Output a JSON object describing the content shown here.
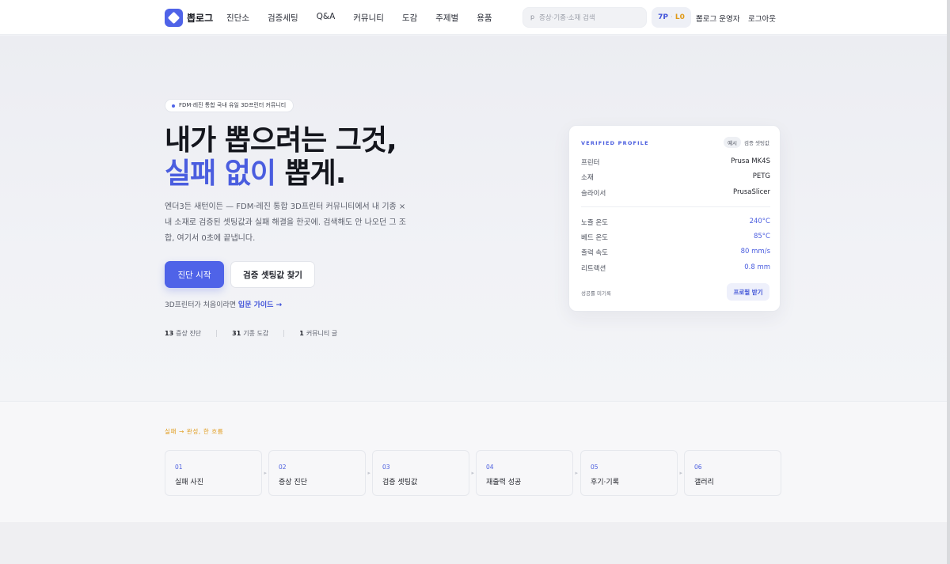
{
  "nav": {
    "logo_text": "뽑로그",
    "menu": [
      "진단소",
      "검증세팅",
      "Q&A",
      "커뮤니티",
      "도감",
      "주제별",
      "용품"
    ],
    "search_placeholder": "증상·기종·소재 검색",
    "search_icon": "p",
    "points": {
      "value": "7P",
      "separator": "·",
      "level": "L0"
    },
    "admin_link": "뽑로그 운영자",
    "logout_link": "로그아웃"
  },
  "hero": {
    "pill": "FDM·레진 통합 국내 유일 3D프린터 커뮤니티",
    "headline_line1": "내가 뽑으려는 그것,",
    "headline_accent": "실패 없이",
    "headline_rest": " 뽑게.",
    "description": "엔더3든 새턴이든 — FDM·레진 통합 3D프린터 커뮤니티에서 내 기종 × 내 소재로 검증된 셋팅값과 실패 해결을 한곳에. 검색해도 안 나오던 그 조합, 여기서 0초에 끝냅니다.",
    "primary_button": "진단 시작",
    "secondary_button": "검증 셋팅값 찾기",
    "guide_prefix": "3D프린터가 처음이라면",
    "guide_link": "입문 가이드",
    "guide_arrow": "→",
    "stats": [
      {
        "num": "13",
        "label": "증상 진단"
      },
      {
        "num": "31",
        "label": "기종 도감"
      },
      {
        "num": "1",
        "label": "커뮤니티 글"
      }
    ]
  },
  "card": {
    "label": "VERIFIED PROFILE",
    "tag_example": "예시",
    "tag_text": "검증 셋팅값",
    "rows_top": [
      {
        "k": "프린터",
        "v": "Prusa MK4S"
      },
      {
        "k": "소재",
        "v": "PETG"
      },
      {
        "k": "슬라이서",
        "v": "PrusaSlicer"
      }
    ],
    "rows_bottom": [
      {
        "k": "노즐 온도",
        "v": "240°C"
      },
      {
        "k": "베드 온도",
        "v": "85°C"
      },
      {
        "k": "출력 속도",
        "v": "80 mm/s"
      },
      {
        "k": "리트랙션",
        "v": "0.8 mm"
      }
    ],
    "footer": "성공률 미기록",
    "button": "프로필 받기"
  },
  "flow": {
    "title": "실패 → 완성, 한 흐름",
    "steps": [
      {
        "num": "01",
        "label": "실패 사진"
      },
      {
        "num": "02",
        "label": "증상 진단"
      },
      {
        "num": "03",
        "label": "검증 셋팅값"
      },
      {
        "num": "04",
        "label": "재출력 성공"
      },
      {
        "num": "05",
        "label": "후기·기록"
      },
      {
        "num": "06",
        "label": "갤러리"
      }
    ]
  },
  "colors": {
    "accent": "#4f63e8",
    "level": "#e09a18"
  }
}
